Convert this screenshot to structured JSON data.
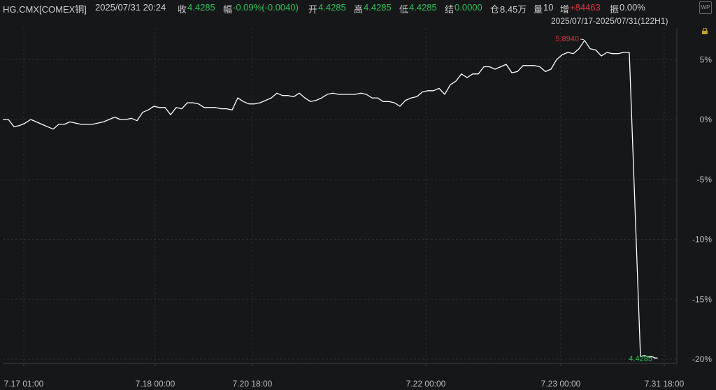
{
  "header": {
    "symbol": "HG.CMX[COMEX铜]",
    "datetime": "2025/07/31 20:24",
    "close_label": "收",
    "close_value": "4.4285",
    "change_label": "幅",
    "change_value": "-0.09%(-0.0040)",
    "open_label": "开",
    "open_value": "4.4285",
    "high_label": "高",
    "high_value": "4.4285",
    "low_label": "低",
    "low_value": "4.4285",
    "settle_label": "结",
    "settle_value": "0.0000",
    "oi_label": "仓",
    "oi_value": "8.45万",
    "volume_label": "量",
    "volume_value": "10",
    "oi_change_label": "增",
    "oi_change_value": "+84463",
    "amplitude_label": "振",
    "amplitude_value": "0.00%",
    "range_text": "2025/07/17-2025/07/31(122H1)",
    "settings_icon": "wp-settings-icon"
  },
  "colors": {
    "up": "#e0353f",
    "down": "#2ec45a",
    "line": "#ffffff",
    "grid": "#2a2c30",
    "bg": "#161719"
  },
  "chart_data": {
    "type": "line",
    "title": "",
    "x_tick_labels": [
      "7.17 01:00",
      "7.18 00:00",
      "7.20 18:00",
      "7.22 00:00",
      "7.23 00:00",
      "7.31 18:00"
    ],
    "y_tick_labels": [
      "5%",
      "0%",
      "-5%",
      "-10%",
      "-15%",
      "-20%"
    ],
    "y_ticks": [
      5,
      0,
      -5,
      -10,
      -15,
      -20
    ],
    "ylim": [
      -20,
      6.5
    ],
    "grid": true,
    "max_label": "5.8940",
    "min_label": "4.4285",
    "series": [
      {
        "values": [
          0.0,
          0.0,
          -0.6,
          -0.5,
          -0.3,
          0.0,
          -0.2,
          -0.4,
          -0.6,
          -0.8,
          -0.4,
          -0.4,
          -0.2,
          -0.3,
          -0.4,
          -0.4,
          -0.4,
          -0.3,
          -0.2,
          0.0,
          0.2,
          0.0,
          0.0,
          0.1,
          -0.1,
          0.6,
          0.8,
          1.1,
          1.0,
          1.0,
          0.4,
          1.0,
          0.9,
          1.4,
          1.4,
          1.3,
          1.0,
          1.0,
          1.0,
          0.9,
          0.9,
          0.8,
          1.8,
          1.5,
          1.3,
          1.3,
          1.4,
          1.6,
          1.8,
          2.2,
          2.0,
          2.0,
          1.9,
          2.2,
          1.8,
          1.5,
          1.6,
          1.8,
          2.1,
          2.2,
          2.1,
          2.1,
          2.1,
          2.1,
          2.2,
          2.1,
          1.8,
          1.8,
          1.5,
          1.5,
          1.4,
          1.1,
          1.6,
          1.8,
          1.9,
          2.3,
          2.4,
          2.4,
          2.6,
          2.1,
          2.9,
          3.2,
          3.8,
          3.5,
          3.8,
          3.8,
          4.4,
          4.4,
          4.2,
          4.4,
          4.6,
          3.9,
          4.0,
          4.5,
          4.5,
          4.5,
          4.4,
          4.0,
          4.2,
          5.0,
          5.4,
          5.6,
          5.5,
          5.9,
          6.6,
          5.9,
          5.8,
          5.3,
          5.6,
          5.5,
          5.5,
          5.6,
          5.6,
          -19.8,
          -19.7,
          -19.7,
          -19.8,
          -19.8,
          -19.8,
          -19.9,
          -19.9
        ]
      }
    ]
  }
}
